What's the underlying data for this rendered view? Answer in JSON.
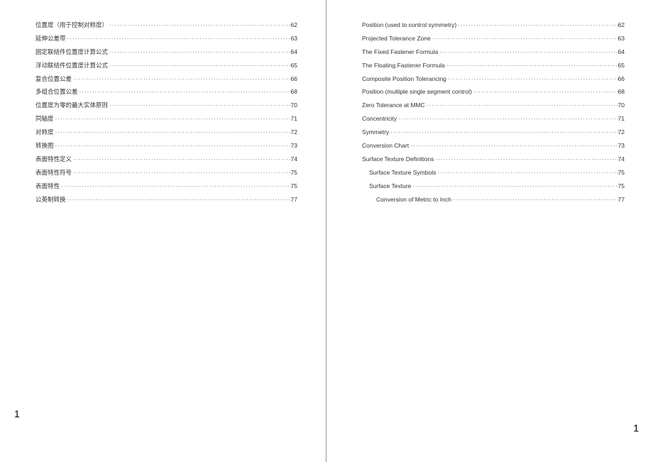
{
  "left": {
    "entries": [
      {
        "title": "位置度（用于控制对称度）",
        "page": "62",
        "indent": 0
      },
      {
        "title": "延伸公差带",
        "page": "63",
        "indent": 0
      },
      {
        "title": "固定联结件位置度计算公式",
        "page": "64",
        "indent": 0
      },
      {
        "title": "浮动联结件位置度计算公式",
        "page": "65",
        "indent": 0
      },
      {
        "title": "复合位置公差",
        "page": "66",
        "indent": 0
      },
      {
        "title": "多组合位置公差",
        "page": "68",
        "indent": 0
      },
      {
        "title": "位置度为零的最大实体原则",
        "page": "70",
        "indent": 0
      },
      {
        "title": "同轴度",
        "page": "71",
        "indent": 0
      },
      {
        "title": "对称度",
        "page": "72",
        "indent": 0
      },
      {
        "title": "转换图",
        "page": "73",
        "indent": 0
      },
      {
        "title": "表面特性定义",
        "page": "74",
        "indent": 0
      },
      {
        "title": "表面特性符号",
        "page": "75",
        "indent": 0
      },
      {
        "title": "表面特性",
        "page": "75",
        "indent": 0
      },
      {
        "title": "公英制转换",
        "page": "77",
        "indent": 0
      }
    ],
    "footer": "1"
  },
  "right": {
    "entries": [
      {
        "title": "Position (used to control symmetry)",
        "page": "62",
        "indent": 0
      },
      {
        "title": "Projected Tolerance Zone",
        "page": "63",
        "indent": 0
      },
      {
        "title": "The Fixed Fastener Formula",
        "page": "64",
        "indent": 0
      },
      {
        "title": "The Floating Fastener Formula",
        "page": "65",
        "indent": 0
      },
      {
        "title": "Composite Position Tolerancing",
        "page": "66",
        "indent": 0
      },
      {
        "title": "Position (multiple single segment control)",
        "page": "68",
        "indent": 0
      },
      {
        "title": "Zero Tolerance at MMC",
        "page": "70",
        "indent": 0
      },
      {
        "title": "Concentricity",
        "page": "71",
        "indent": 0
      },
      {
        "title": "Symmetry",
        "page": "72",
        "indent": 0
      },
      {
        "title": "Conversion Chart",
        "page": "73",
        "indent": 0
      },
      {
        "title": "Surface Texture Definitions",
        "page": "74",
        "indent": 0
      },
      {
        "title": "Surface Texture Symbols",
        "page": "75",
        "indent": 1
      },
      {
        "title": "Surface Texture",
        "page": "75",
        "indent": 1
      },
      {
        "title": "Conversion of Metric to Inch",
        "page": "77",
        "indent": 2
      }
    ],
    "footer": "1"
  }
}
